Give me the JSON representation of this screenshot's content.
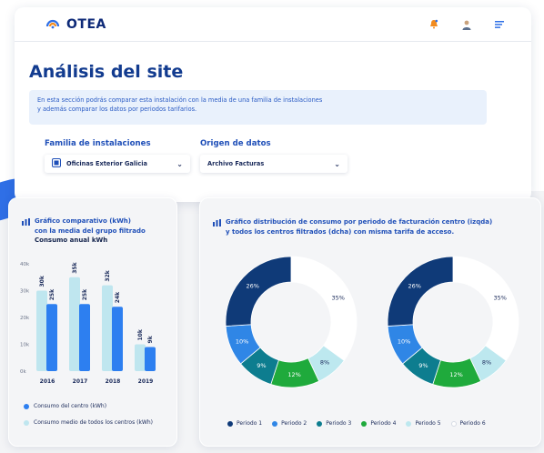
{
  "app": {
    "brand": "OTEA",
    "colors": {
      "primary": "#123b8f",
      "accent": "#1f4fb8",
      "orange": "#f28b1e"
    }
  },
  "topbar": {
    "icons": [
      "notification-bell-icon",
      "user-avatar-icon",
      "menu-icon"
    ]
  },
  "page": {
    "title": "Análisis del site",
    "info_line1": "En esta sección podrás comparar esta instalación con la media de una familia de instalaciones",
    "info_line2": "y además comparar los datos por periodos tarifarios."
  },
  "filters": {
    "familia_label": "Familia de instalaciones",
    "familia_value": "Oficinas Exterior Galicia",
    "origen_label": "Origen de datos",
    "origen_value": "Archivo Facturas"
  },
  "bar_card": {
    "title_line1": "Gráfico comparativo (kWh)",
    "title_line2": "con la media del grupo filtrado",
    "title_line3": "Consumo anual kWh",
    "legend_centro": "Consumo del centro (kWh)",
    "legend_media": "Consumo medio de todos los centros (kWh)"
  },
  "donut_card": {
    "title_line1": "Gráfico distribución de consumo por periodo de facturación centro (izqda)",
    "title_line2": "y todos los centros filtrados (dcha) con misma tarifa de acceso."
  },
  "chart_data": [
    {
      "type": "bar",
      "title": "Consumo anual kWh",
      "categories": [
        "2016",
        "2017",
        "2018",
        "2019"
      ],
      "ylim": [
        0,
        40000
      ],
      "ytick_labels": [
        "0k",
        "10k",
        "20k",
        "30k",
        "40k"
      ],
      "series": [
        {
          "name": "Consumo medio de todos los centros (kWh)",
          "color": "#bfe6ef",
          "values": [
            30000,
            35000,
            32000,
            10000
          ],
          "labels": [
            "30k",
            "35k",
            "32k",
            "10k"
          ]
        },
        {
          "name": "Consumo del centro (kWh)",
          "color": "#2d7ff0",
          "values": [
            25000,
            25000,
            24000,
            9000
          ],
          "labels": [
            "25k",
            "25k",
            "24k",
            "9k"
          ]
        }
      ]
    },
    {
      "type": "pie",
      "name": "centro",
      "labels": [
        "Periodo 1",
        "Periodo 2",
        "Periodo 3",
        "Periodo 4",
        "Periodo 5",
        "Periodo 6"
      ],
      "values": [
        26,
        10,
        9,
        12,
        8,
        35
      ],
      "value_labels": [
        "26%",
        "10%",
        "9%",
        "12%",
        "8%",
        "35%"
      ],
      "colors": [
        "#0f3a78",
        "#2f86e6",
        "#0d7d8f",
        "#1faa3c",
        "#bde8ef",
        "#ffffff"
      ]
    },
    {
      "type": "pie",
      "name": "todos los centros filtrados",
      "labels": [
        "Periodo 1",
        "Periodo 2",
        "Periodo 3",
        "Periodo 4",
        "Periodo 5",
        "Periodo 6"
      ],
      "values": [
        26,
        10,
        9,
        12,
        8,
        35
      ],
      "value_labels": [
        "26%",
        "10%",
        "9%",
        "12%",
        "8%",
        "35%"
      ],
      "colors": [
        "#0f3a78",
        "#2f86e6",
        "#0d7d8f",
        "#1faa3c",
        "#bde8ef",
        "#ffffff"
      ]
    }
  ]
}
